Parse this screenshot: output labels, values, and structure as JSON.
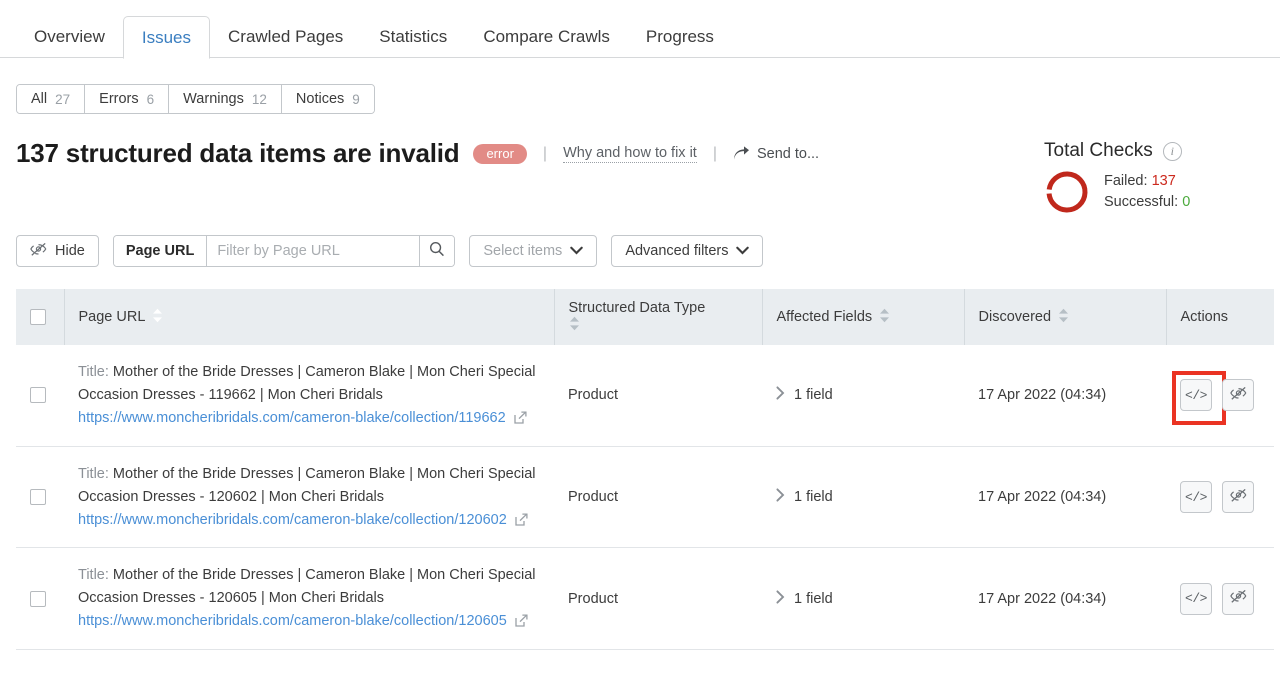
{
  "tabs": [
    {
      "label": "Overview",
      "active": false
    },
    {
      "label": "Issues",
      "active": true
    },
    {
      "label": "Crawled Pages",
      "active": false
    },
    {
      "label": "Statistics",
      "active": false
    },
    {
      "label": "Compare Crawls",
      "active": false
    },
    {
      "label": "Progress",
      "active": false
    }
  ],
  "chips": [
    {
      "label": "All",
      "count": "27"
    },
    {
      "label": "Errors",
      "count": "6"
    },
    {
      "label": "Warnings",
      "count": "12"
    },
    {
      "label": "Notices",
      "count": "9"
    }
  ],
  "header": {
    "title": "137 structured data items are invalid",
    "badge": "error",
    "divider": "|",
    "fix_link": "Why and how to fix it",
    "send_to": "Send to..."
  },
  "total_checks": {
    "heading": "Total Checks",
    "failed_label": "Failed:",
    "failed_value": "137",
    "successful_label": "Successful:",
    "successful_value": "0",
    "ring_color": "#c0281c",
    "failed_color": "#cc2a1e",
    "successful_color": "#4aaa3c"
  },
  "toolbar": {
    "hide_label": "Hide",
    "search_prefix": "Page URL",
    "search_value": "",
    "search_placeholder": "Filter by Page URL",
    "select_items_label": "Select items",
    "advanced_filters_label": "Advanced filters"
  },
  "table": {
    "columns": {
      "page_url": "Page URL",
      "structured_data_type": "Structured Data Type",
      "affected_fields": "Affected Fields",
      "discovered": "Discovered",
      "actions": "Actions"
    },
    "header_accent_color": "#4e97dd",
    "rows": [
      {
        "title_label": "Title:",
        "title_text": "Mother of the Bride Dresses | Cameron Blake | Mon Cheri Special Occasion Dresses - 119662 | Mon Cheri Bridals",
        "url": "https://www.moncheribridals.com/cameron-blake/collection/119662",
        "structured_data_type": "Product",
        "affected_fields": "1 field",
        "discovered": "17 Apr 2022 (04:34)",
        "highlighted": true
      },
      {
        "title_label": "Title:",
        "title_text": "Mother of the Bride Dresses | Cameron Blake | Mon Cheri Special Occasion Dresses - 120602 | Mon Cheri Bridals",
        "url": "https://www.moncheribridals.com/cameron-blake/collection/120602",
        "structured_data_type": "Product",
        "affected_fields": "1 field",
        "discovered": "17 Apr 2022 (04:34)",
        "highlighted": false
      },
      {
        "title_label": "Title:",
        "title_text": "Mother of the Bride Dresses | Cameron Blake | Mon Cheri Special Occasion Dresses - 120605 | Mon Cheri Bridals",
        "url": "https://www.moncheribridals.com/cameron-blake/collection/120605",
        "structured_data_type": "Product",
        "affected_fields": "1 field",
        "discovered": "17 Apr 2022 (04:34)",
        "highlighted": false
      }
    ],
    "icons": {
      "view_code": "code-icon",
      "hide_row": "eye-slash-icon",
      "external_link": "external-link-icon",
      "expand": "chevron-right-icon",
      "sort": "sort-arrows-icon"
    }
  }
}
